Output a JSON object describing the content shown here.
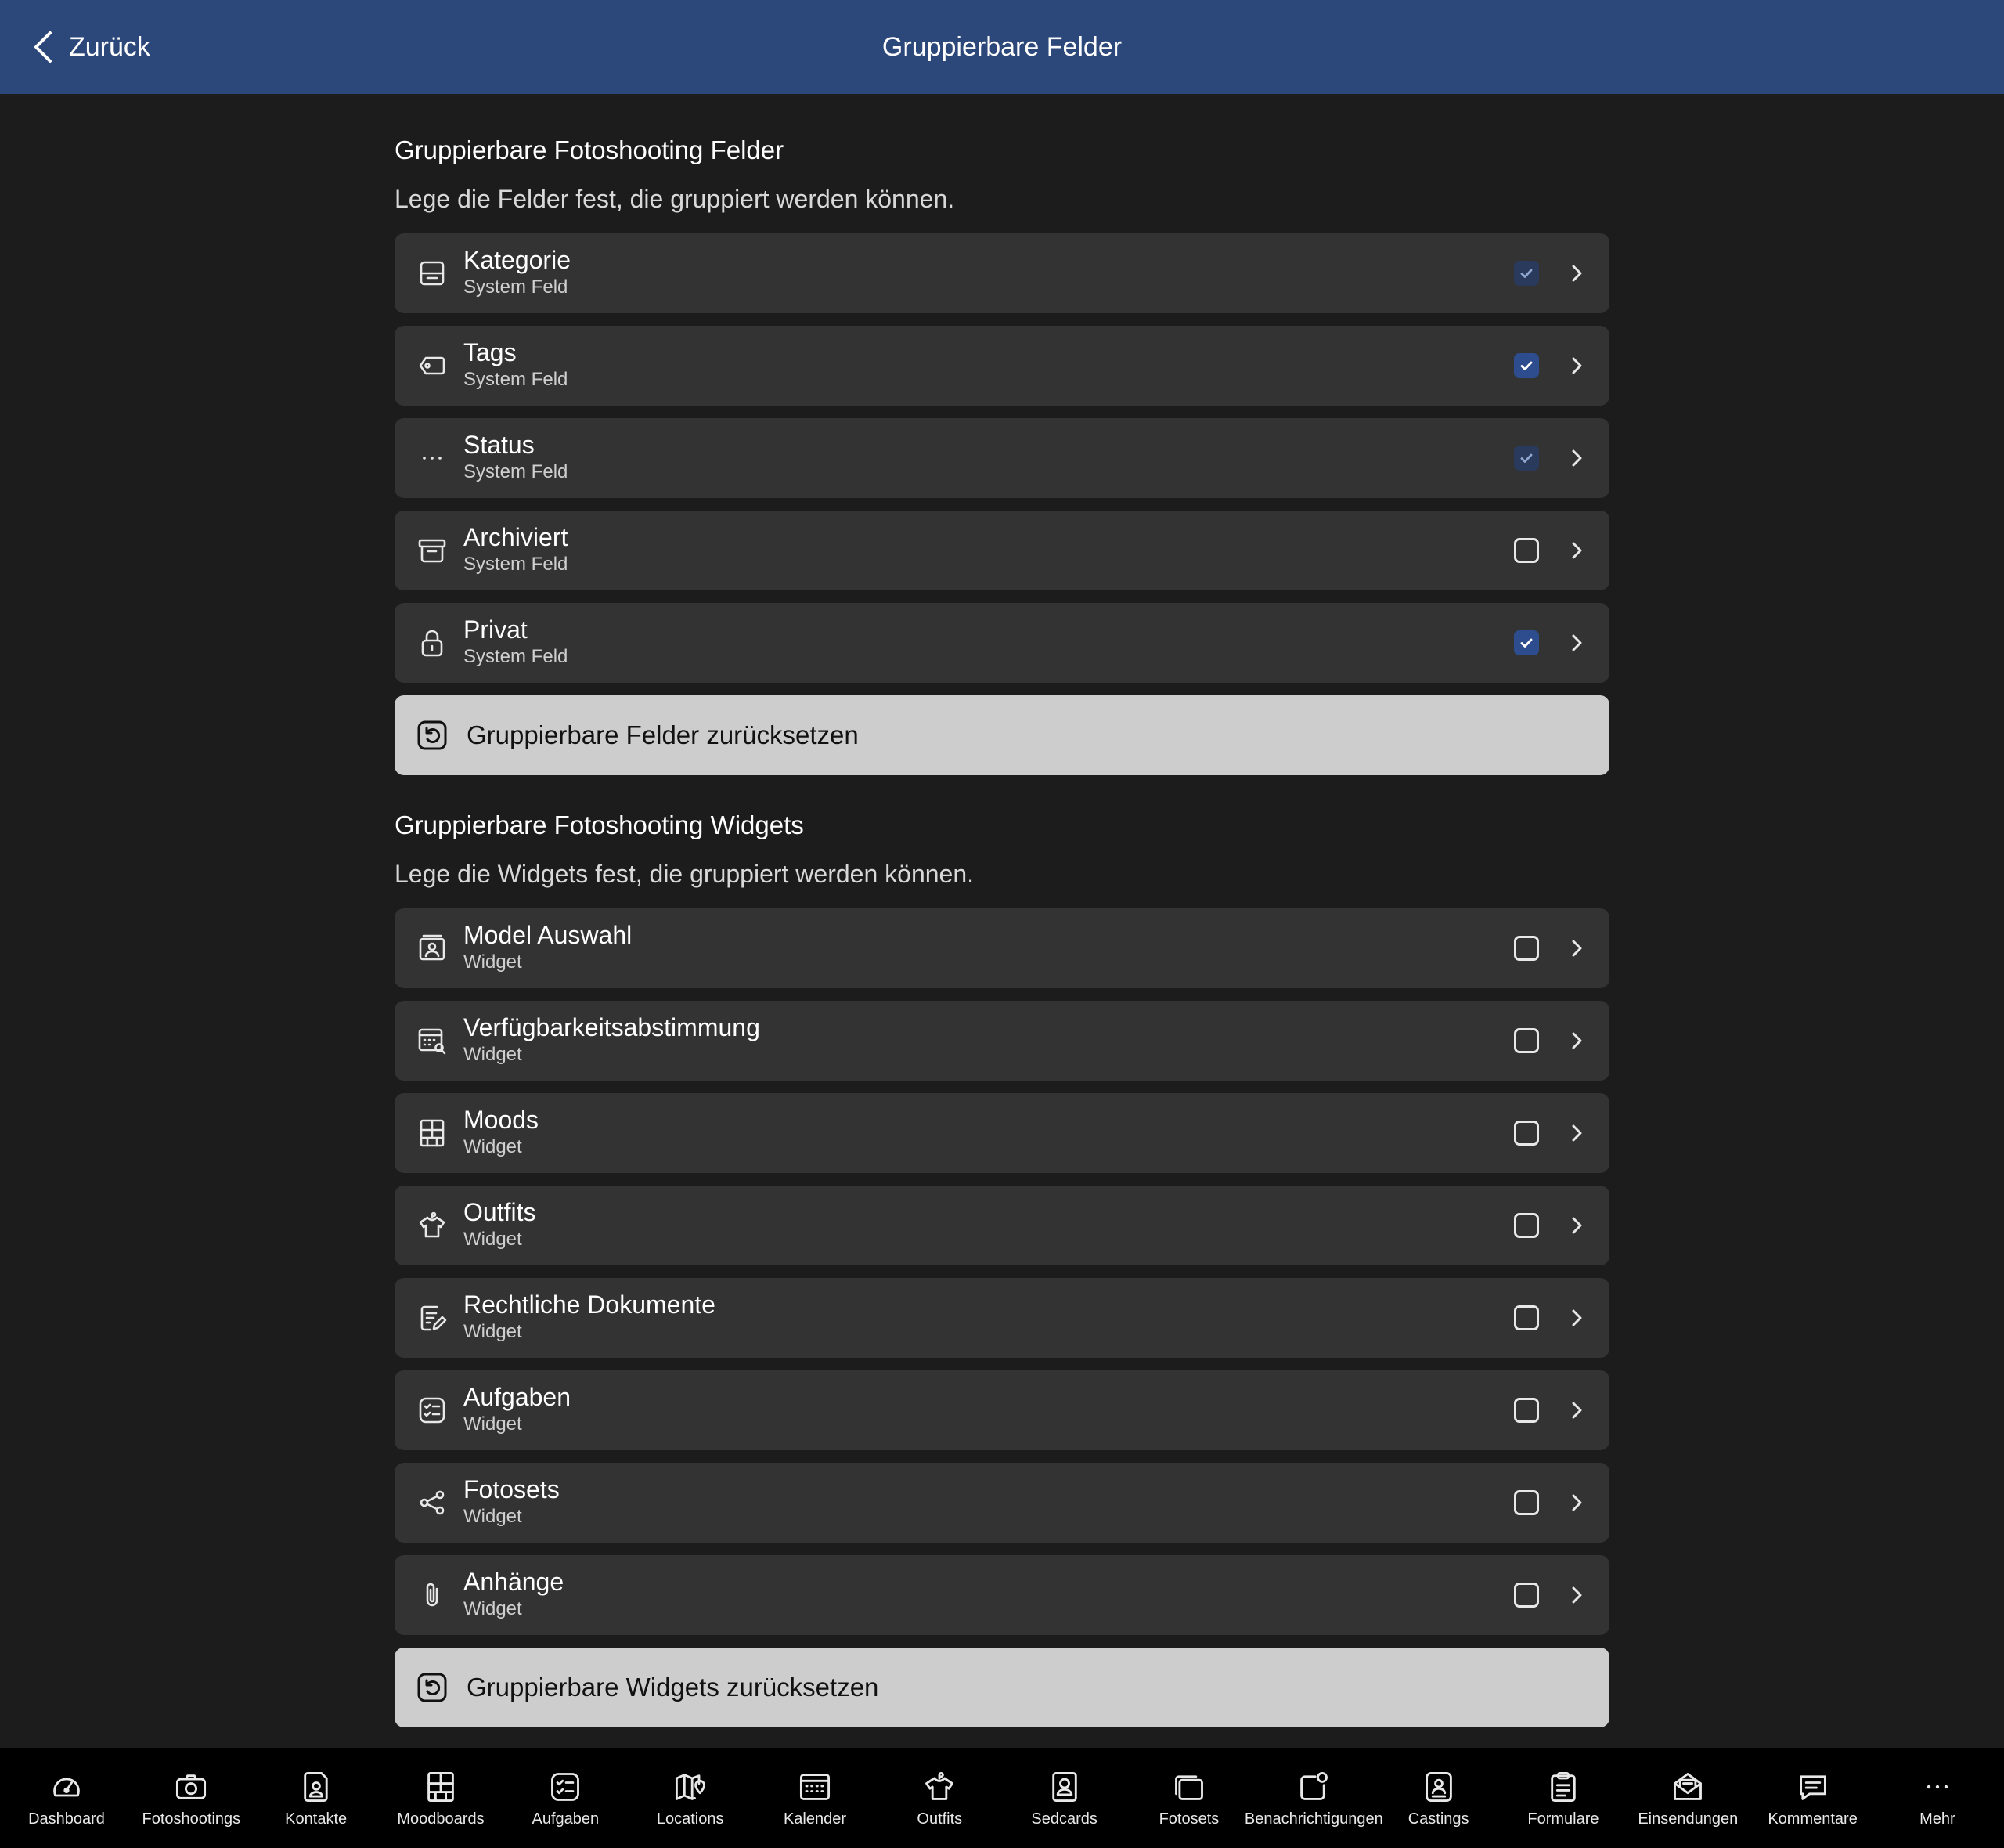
{
  "header": {
    "back_label": "Zurück",
    "title": "Gruppierbare Felder"
  },
  "fields_section": {
    "title": "Gruppierbare Fotoshooting Felder",
    "description": "Lege die Felder fest, die gruppiert werden können.",
    "items": [
      {
        "name": "Kategorie",
        "type": "System Feld",
        "icon": "inbox-icon",
        "checked": true,
        "disabled": true
      },
      {
        "name": "Tags",
        "type": "System Feld",
        "icon": "tag-icon",
        "checked": true,
        "disabled": false
      },
      {
        "name": "Status",
        "type": "System Feld",
        "icon": "ellipsis-icon",
        "checked": true,
        "disabled": true
      },
      {
        "name": "Archiviert",
        "type": "System Feld",
        "icon": "archive-icon",
        "checked": false,
        "disabled": false
      },
      {
        "name": "Privat",
        "type": "System Feld",
        "icon": "lock-icon",
        "checked": true,
        "disabled": false
      }
    ],
    "reset_label": "Gruppierbare Felder zurücksetzen"
  },
  "widgets_section": {
    "title": "Gruppierbare Fotoshooting Widgets",
    "description": "Lege die Widgets fest, die gruppiert werden können.",
    "items": [
      {
        "name": "Model Auswahl",
        "type": "Widget",
        "icon": "model-icon",
        "checked": false
      },
      {
        "name": "Verfügbarkeitsabstimmung",
        "type": "Widget",
        "icon": "calendar-search-icon",
        "checked": false
      },
      {
        "name": "Moods",
        "type": "Widget",
        "icon": "moodboard-icon",
        "checked": false
      },
      {
        "name": "Outfits",
        "type": "Widget",
        "icon": "shirt-icon",
        "checked": false
      },
      {
        "name": "Rechtliche Dokumente",
        "type": "Widget",
        "icon": "document-edit-icon",
        "checked": false
      },
      {
        "name": "Aufgaben",
        "type": "Widget",
        "icon": "tasks-icon",
        "checked": false
      },
      {
        "name": "Fotosets",
        "type": "Widget",
        "icon": "share-icon",
        "checked": false
      },
      {
        "name": "Anhänge",
        "type": "Widget",
        "icon": "paperclip-icon",
        "checked": false
      }
    ],
    "reset_label": "Gruppierbare Widgets zurücksetzen"
  },
  "tabbar": [
    {
      "label": "Dashboard",
      "icon": "gauge-icon"
    },
    {
      "label": "Fotoshootings",
      "icon": "camera-icon"
    },
    {
      "label": "Kontakte",
      "icon": "contact-icon"
    },
    {
      "label": "Moodboards",
      "icon": "moodboard-icon"
    },
    {
      "label": "Aufgaben",
      "icon": "tasks-icon"
    },
    {
      "label": "Locations",
      "icon": "map-icon"
    },
    {
      "label": "Kalender",
      "icon": "calendar-icon"
    },
    {
      "label": "Outfits",
      "icon": "shirt-icon"
    },
    {
      "label": "Sedcards",
      "icon": "sedcard-icon"
    },
    {
      "label": "Fotosets",
      "icon": "photoset-icon"
    },
    {
      "label": "Benachrichtigungen",
      "icon": "notification-icon"
    },
    {
      "label": "Castings",
      "icon": "casting-icon"
    },
    {
      "label": "Formulare",
      "icon": "clipboard-icon"
    },
    {
      "label": "Einsendungen",
      "icon": "mail-open-icon"
    },
    {
      "label": "Kommentare",
      "icon": "comment-icon"
    },
    {
      "label": "Mehr",
      "icon": "more-icon"
    }
  ],
  "colors": {
    "header_bg": "#2c477a",
    "page_bg": "#1c1c1c",
    "row_bg": "#333333",
    "reset_bg": "#cdcdcd",
    "checkbox_checked": "#2d4d8e",
    "tabbar_bg": "#000000"
  }
}
